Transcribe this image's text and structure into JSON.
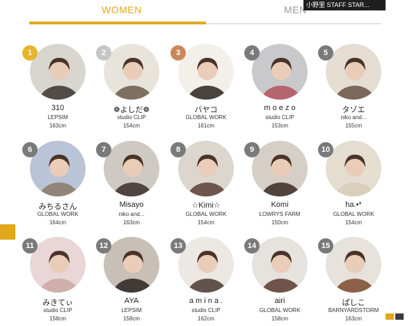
{
  "tabs": {
    "women": "WOMEN",
    "men": "MEN"
  },
  "overlay_text": "小野里 STAFF STAR...",
  "colors": {
    "accent": "#e0a81a",
    "badge_gold": "#e6b52a",
    "badge_silver": "#c7c7c7",
    "badge_bronze": "#c9895a",
    "badge_default": "#7a7a7a"
  },
  "staff": [
    {
      "rank": "1",
      "name": "310",
      "brand": "LEPSIM",
      "height": "163cm"
    },
    {
      "rank": "2",
      "name": "❁よしだ❁",
      "brand": "studio CLIP",
      "height": "154cm"
    },
    {
      "rank": "3",
      "name": "バヤコ",
      "brand": "GLOBAL WORK",
      "height": "161cm"
    },
    {
      "rank": "4",
      "name": "m o e z o",
      "brand": "studio CLIP",
      "height": "153cm"
    },
    {
      "rank": "5",
      "name": "タゾエ",
      "brand": "niko and...",
      "height": "155cm"
    },
    {
      "rank": "6",
      "name": "みちるさん",
      "brand": "GLOBAL WORK",
      "height": "164cm"
    },
    {
      "rank": "7",
      "name": "Misayo",
      "brand": "niko and...",
      "height": "163cm"
    },
    {
      "rank": "8",
      "name": "☆Kimi☆",
      "brand": "GLOBAL WORK",
      "height": "154cm"
    },
    {
      "rank": "9",
      "name": "Komi",
      "brand": "LOWRYS FARM",
      "height": "150cm"
    },
    {
      "rank": "10",
      "name": "ha.•*",
      "brand": "GLOBAL WORK",
      "height": "154cm"
    },
    {
      "rank": "11",
      "name": "みきてぃ",
      "brand": "studio CLIP",
      "height": "158cm"
    },
    {
      "rank": "12",
      "name": "AYA",
      "brand": "LEPSIM",
      "height": "158cm"
    },
    {
      "rank": "13",
      "name": "a m i n a .",
      "brand": "studio CLIP",
      "height": "162cm"
    },
    {
      "rank": "14",
      "name": "airi",
      "brand": "GLOBAL WORK",
      "height": "158cm"
    },
    {
      "rank": "15",
      "name": "ぱしこ",
      "brand": "BARNYARDSTORM",
      "height": "163cm"
    }
  ]
}
